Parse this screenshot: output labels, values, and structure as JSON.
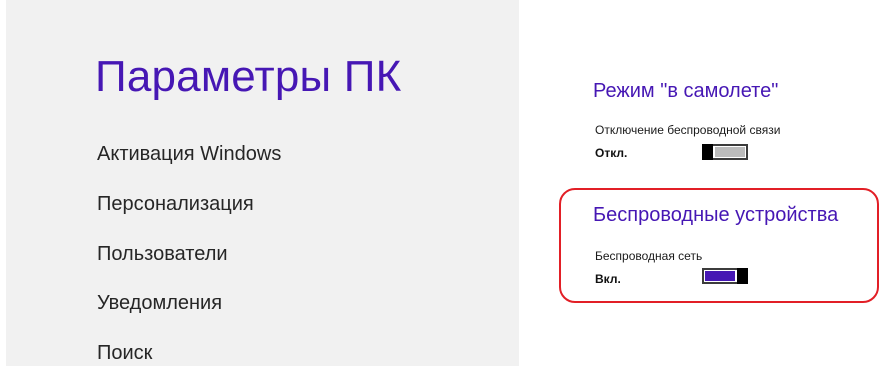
{
  "left": {
    "title": "Параметры ПК",
    "nav_items": [
      {
        "label": "Активация Windows"
      },
      {
        "label": "Персонализация"
      },
      {
        "label": "Пользователи"
      },
      {
        "label": "Уведомления"
      },
      {
        "label": "Поиск"
      }
    ]
  },
  "right": {
    "airplane": {
      "title": "Режим \"в самолете\"",
      "setting_label": "Отключение беспроводной связи",
      "state": "Откл.",
      "is_on": false
    },
    "wireless": {
      "title": "Беспроводные устройства",
      "setting_label": "Беспроводная сеть",
      "state": "Вкл.",
      "is_on": true
    }
  },
  "colors": {
    "accent": "#4617b4",
    "left_background": "#f1f1f1",
    "toggle_off": "#bcbcbc",
    "highlight_outline": "#e21f26"
  }
}
